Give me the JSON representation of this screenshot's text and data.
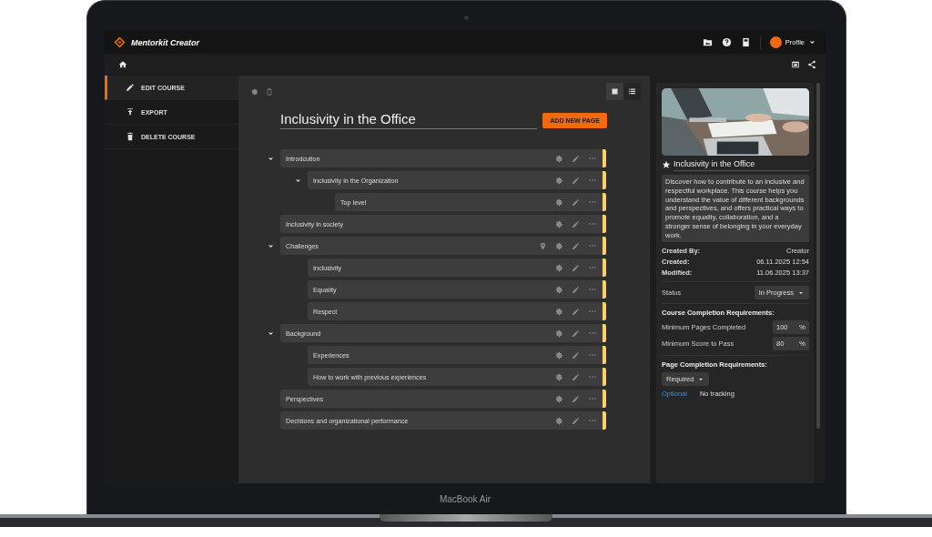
{
  "app": {
    "name": "Mentorkit Creator",
    "profile": "Profile"
  },
  "sidebar": {
    "items": [
      {
        "label": "EDIT COURSE",
        "selected": true
      },
      {
        "label": "EXPORT",
        "selected": false
      },
      {
        "label": "DELETE COURSE",
        "selected": false
      }
    ]
  },
  "toolbar": {
    "views": [
      {
        "selected": true
      },
      {
        "selected": false
      }
    ]
  },
  "course": {
    "title": "Inclusivity in the Office",
    "add_button": "ADD NEW PAGE"
  },
  "pages": [
    {
      "label": "Introdcution",
      "pinned": false,
      "expanded": true,
      "children": [
        {
          "label": "Inclusivity in the Organization",
          "pinned": false,
          "expanded": true,
          "children": [
            {
              "label": "Top level",
              "pinned": false
            }
          ]
        }
      ]
    },
    {
      "label": "Inclusivity in society",
      "pinned": false
    },
    {
      "label": "Challenges",
      "pinned": true,
      "expanded": true,
      "children": [
        {
          "label": "Inclusivity",
          "pinned": false
        },
        {
          "label": "Equality",
          "pinned": false
        },
        {
          "label": "Respect",
          "pinned": false
        }
      ]
    },
    {
      "label": "Background",
      "pinned": false,
      "expanded": true,
      "children": [
        {
          "label": "Experiences",
          "pinned": false
        },
        {
          "label": "How to work with previous experiences",
          "pinned": false
        }
      ]
    },
    {
      "label": "Perspectives",
      "pinned": false
    },
    {
      "label": "Decisions and organizational performance",
      "pinned": false
    }
  ],
  "details": {
    "title": "Inclusivity in the Office",
    "starred": true,
    "description": "Discover how to contribute to an inclusive and respectful workplace. This course helps you understand the value of different backgrounds and perspectives, and offers practical ways to promote equality, collaboration, and a stronger sense of belonging in your everyday work.",
    "meta": [
      {
        "label": "Created By:",
        "value": "Creator"
      },
      {
        "label": "Created:",
        "value": "06.11.2025 12:54"
      },
      {
        "label": "Modified:",
        "value": "11.06.2025 13:37"
      }
    ],
    "status": {
      "label": "Status",
      "value": "In Progress"
    },
    "course_requirements": {
      "heading": "Course Completion Requirements:",
      "fields": [
        {
          "label": "Minimum Pages Completed",
          "value": "100",
          "unit": "%"
        },
        {
          "label": "Minimum Score to Pass",
          "value": "80",
          "unit": "%"
        }
      ]
    },
    "page_requirements": {
      "heading": "Page Completion Requirements:",
      "value": "Required",
      "options": [
        {
          "label": "Optional",
          "selected": true
        },
        {
          "label": "No tracking",
          "selected": false
        }
      ]
    }
  },
  "laptop": {
    "label": "MacBook Air"
  }
}
